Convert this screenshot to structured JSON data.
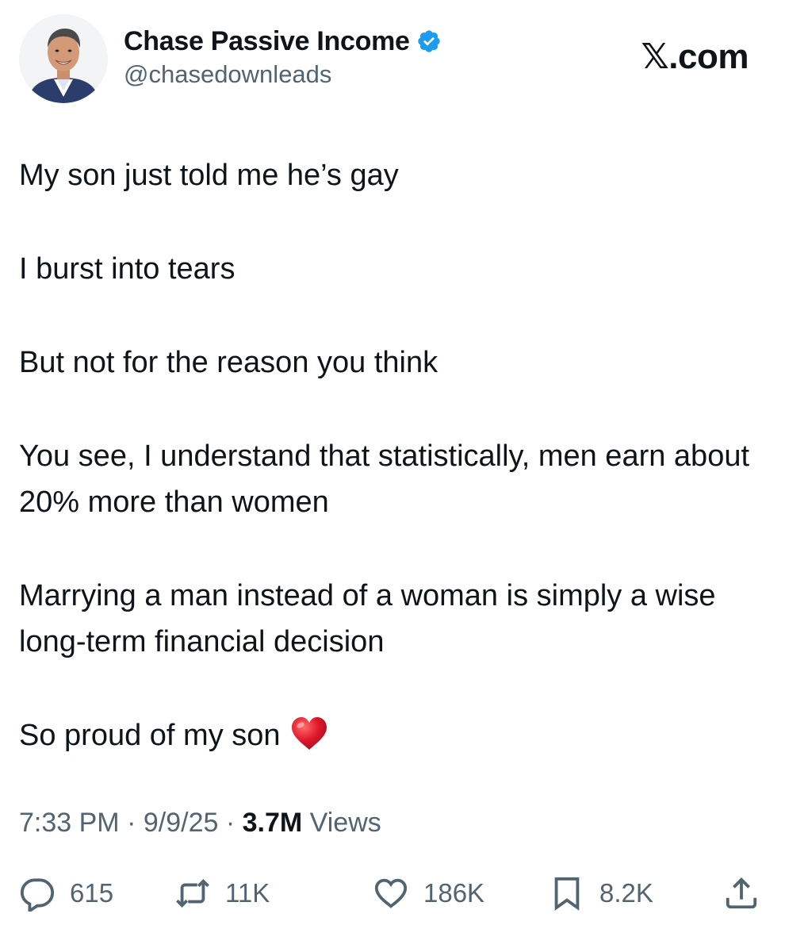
{
  "author": {
    "display_name": "Chase Passive Income",
    "handle": "@chasedownleads",
    "verified": true
  },
  "site_label": "𝕏.com",
  "tweet": {
    "paragraphs": [
      "My son just told me he’s gay",
      "I burst into tears",
      "But not for the reason you think",
      "You see, I understand that statistically, men earn about 20% more than women",
      "Marrying a man instead of a woman is simply a wise long-term financial decision",
      "So proud of my son"
    ],
    "emoji": "red-heart"
  },
  "meta": {
    "time": "7:33 PM",
    "separator": "·",
    "date": "9/9/25",
    "views_count": "3.7M",
    "views_label": "Views"
  },
  "actions": {
    "replies": "615",
    "reposts": "11K",
    "likes": "186K",
    "bookmarks": "8.2K"
  },
  "colors": {
    "text_primary": "#0f1419",
    "text_secondary": "#536471",
    "verified_blue": "#1d9bf0",
    "heart_red": "#e0192b",
    "background": "#ffffff"
  },
  "icons": [
    "verified-badge-icon",
    "reply-icon",
    "repost-icon",
    "like-icon",
    "bookmark-icon",
    "share-icon",
    "heart-emoji-icon"
  ]
}
